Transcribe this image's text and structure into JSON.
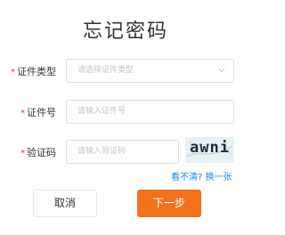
{
  "page": {
    "title": "忘记密码"
  },
  "form": {
    "id_type": {
      "required_mark": "*",
      "label": "证件类型",
      "placeholder": "请选择证件类型"
    },
    "id_number": {
      "required_mark": "*",
      "label": "证件号",
      "placeholder": "请输入证件号"
    },
    "captcha": {
      "required_mark": "*",
      "label": "验证码",
      "placeholder": "请输入验证码",
      "image_text": "awni",
      "refresh_link": "看不清? 换一张"
    }
  },
  "actions": {
    "cancel_label": "取消",
    "next_label": "下一步"
  },
  "colors": {
    "primary": "#f4721e",
    "link": "#1e88e5",
    "required": "#e0423a"
  }
}
